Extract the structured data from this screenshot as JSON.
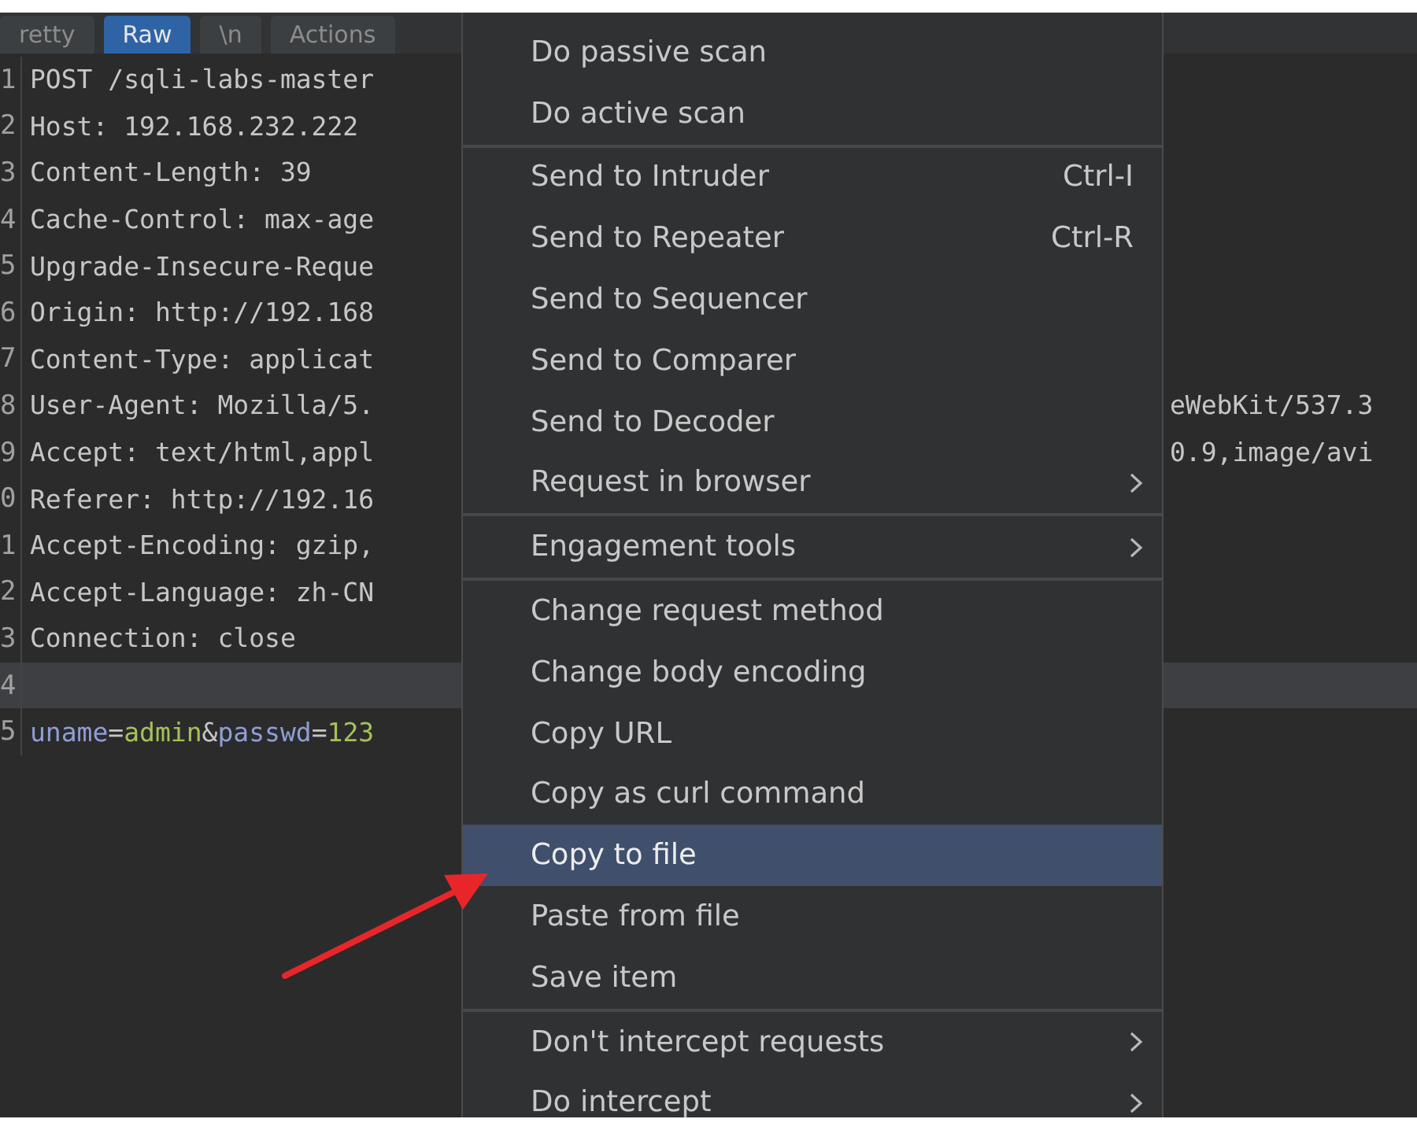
{
  "tabs": [
    {
      "label": "retty",
      "selected": false
    },
    {
      "label": "Raw",
      "selected": true
    },
    {
      "label": "\\n",
      "selected": false
    },
    {
      "label": "Actions",
      "selected": false
    }
  ],
  "editor": {
    "lines": [
      {
        "number": "1",
        "text": "POST /sqli-labs-master",
        "current": false
      },
      {
        "number": "2",
        "text": "Host: 192.168.232.222",
        "current": false
      },
      {
        "number": "3",
        "text": "Content-Length: 39",
        "current": false
      },
      {
        "number": "4",
        "text": "Cache-Control: max-age",
        "current": false
      },
      {
        "number": "5",
        "text": "Upgrade-Insecure-Reque",
        "current": false
      },
      {
        "number": "6",
        "text": "Origin: http://192.168",
        "current": false
      },
      {
        "number": "7",
        "text": "Content-Type: applicat",
        "current": false
      },
      {
        "number": "8",
        "text": "User-Agent: Mozilla/5.",
        "right": "eWebKit/537.3",
        "current": false
      },
      {
        "number": "9",
        "text": "Accept: text/html,appl",
        "right": "0.9,image/avi",
        "current": false
      },
      {
        "number": "0",
        "text": "Referer: http://192.16",
        "current": false
      },
      {
        "number": "1",
        "text": "Accept-Encoding: gzip,",
        "current": false
      },
      {
        "number": "2",
        "text": "Accept-Language: zh-CN",
        "current": false
      },
      {
        "number": "3",
        "text": "Connection: close",
        "current": false
      },
      {
        "number": "4",
        "current": true
      },
      {
        "number": "5",
        "segments": [
          {
            "kind": "key",
            "text": "uname"
          },
          {
            "kind": "plain",
            "text": "="
          },
          {
            "kind": "value",
            "text": "admin"
          },
          {
            "kind": "plain",
            "text": "&"
          },
          {
            "kind": "key",
            "text": "passwd"
          },
          {
            "kind": "plain",
            "text": "="
          },
          {
            "kind": "value",
            "text": "123"
          }
        ],
        "current": false
      }
    ]
  },
  "menu": {
    "groups": [
      [
        {
          "label": "Do passive scan",
          "selected": false,
          "submenu": false
        },
        {
          "label": "Do active scan",
          "selected": false,
          "submenu": false
        }
      ],
      [
        {
          "label": "Send to Intruder",
          "shortcut": "Ctrl-I",
          "selected": false,
          "submenu": false
        },
        {
          "label": "Send to Repeater",
          "shortcut": "Ctrl-R",
          "selected": false,
          "submenu": false
        },
        {
          "label": "Send to Sequencer",
          "selected": false,
          "submenu": false
        },
        {
          "label": "Send to Comparer",
          "selected": false,
          "submenu": false
        },
        {
          "label": "Send to Decoder",
          "selected": false,
          "submenu": false
        },
        {
          "label": "Request in browser",
          "selected": false,
          "submenu": true
        }
      ],
      [
        {
          "label": "Engagement tools",
          "selected": false,
          "submenu": true
        }
      ],
      [
        {
          "label": "Change request method",
          "selected": false,
          "submenu": false
        },
        {
          "label": "Change body encoding",
          "selected": false,
          "submenu": false
        },
        {
          "label": "Copy URL",
          "selected": false,
          "submenu": false
        },
        {
          "label": "Copy as curl command",
          "selected": false,
          "submenu": false
        },
        {
          "label": "Copy to file",
          "selected": true,
          "submenu": false
        },
        {
          "label": "Paste from file",
          "selected": false,
          "submenu": false
        },
        {
          "label": "Save item",
          "selected": false,
          "submenu": false
        }
      ],
      [
        {
          "label": "Don't intercept requests",
          "selected": false,
          "submenu": true
        },
        {
          "label": "Do intercept",
          "selected": false,
          "submenu": true
        }
      ]
    ]
  }
}
